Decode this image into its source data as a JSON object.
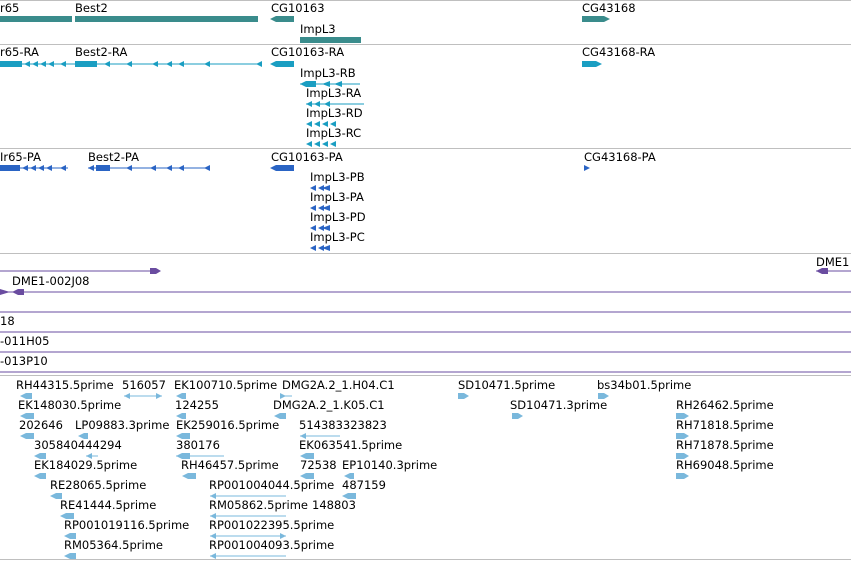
{
  "colors": {
    "gene": "#3a8c8c",
    "transcript": "#1a9ec2",
    "protein": "#2a64c4",
    "clone": "#6a4ca0",
    "est": "#7ab8dc"
  },
  "tracks": {
    "genes": [
      {
        "label": "r65"
      },
      {
        "label": "Best2"
      },
      {
        "label": "CG10163"
      },
      {
        "label": "ImpL3"
      },
      {
        "label": "CG43168"
      }
    ],
    "transcripts": [
      {
        "label": "r65-RA"
      },
      {
        "label": "Best2-RA"
      },
      {
        "label": "CG10163-RA"
      },
      {
        "label": "ImpL3-RB"
      },
      {
        "label": "ImpL3-RA"
      },
      {
        "label": "ImpL3-RD"
      },
      {
        "label": "ImpL3-RC"
      },
      {
        "label": "CG43168-RA"
      }
    ],
    "proteins": [
      {
        "label": "Ir65-PA"
      },
      {
        "label": "Best2-PA"
      },
      {
        "label": "CG10163-PA"
      },
      {
        "label": "ImpL3-PB"
      },
      {
        "label": "ImpL3-PA"
      },
      {
        "label": "ImpL3-PD"
      },
      {
        "label": "ImpL3-PC"
      },
      {
        "label": "CG43168-PA"
      }
    ],
    "clones": [
      {
        "label": "DME1"
      },
      {
        "label": "DME1-002J08"
      }
    ],
    "lines": [
      {
        "label": "18"
      },
      {
        "label": "-011H05"
      },
      {
        "label": "-013P10"
      }
    ],
    "ests": [
      {
        "label": "RH44315.5prime"
      },
      {
        "label": "516057"
      },
      {
        "label": "EK100710.5prime"
      },
      {
        "label": "DMG2A.2_1.H04.C1"
      },
      {
        "label": "SD10471.5prime"
      },
      {
        "label": "bs34b01.5prime"
      },
      {
        "label": "EK148030.5prime"
      },
      {
        "label": "124255"
      },
      {
        "label": "DMG2A.2_1.K05.C1"
      },
      {
        "label": "SD10471.3prime"
      },
      {
        "label": "RH26462.5prime"
      },
      {
        "label": "202646"
      },
      {
        "label": "LP09883.3prime"
      },
      {
        "label": "EK259016.5prime"
      },
      {
        "label": "514383323823"
      },
      {
        "label": "RH71818.5prime"
      },
      {
        "label": "305840444294"
      },
      {
        "label": "380176"
      },
      {
        "label": "EK063541.5prime"
      },
      {
        "label": "RH71878.5prime"
      },
      {
        "label": "EK184029.5prime"
      },
      {
        "label": "RH46457.5prime"
      },
      {
        "label": "72538"
      },
      {
        "label": "EP10140.3prime"
      },
      {
        "label": "RH69048.5prime"
      },
      {
        "label": "RE28065.5prime"
      },
      {
        "label": "RP001004044.5prime"
      },
      {
        "label": "487159"
      },
      {
        "label": "RE41444.5prime"
      },
      {
        "label": "RM05862.5prime"
      },
      {
        "label": "148803"
      },
      {
        "label": "RP001019116.5prime"
      },
      {
        "label": "RP001022395.5prime"
      },
      {
        "label": "RM05364.5prime"
      },
      {
        "label": "RP001004093.5prime"
      }
    ]
  }
}
